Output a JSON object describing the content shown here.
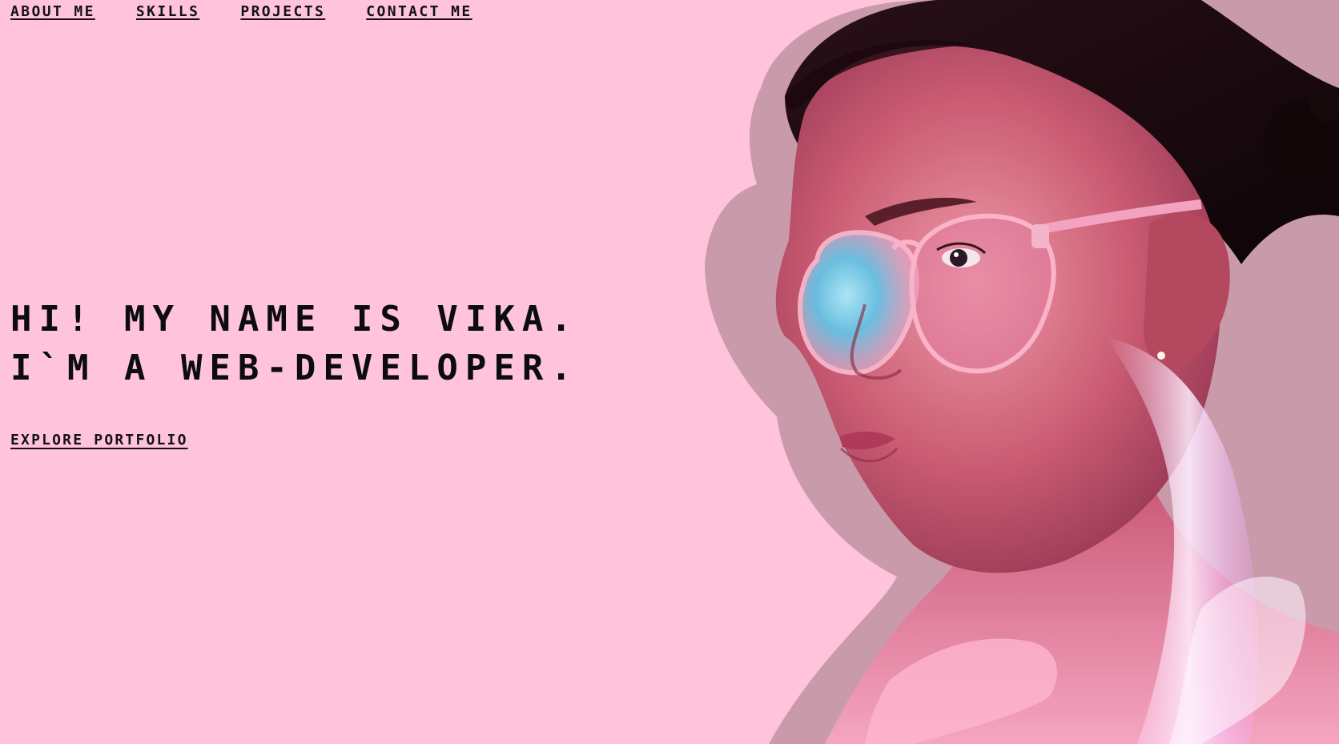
{
  "nav": {
    "items": [
      {
        "label": "ABOUT ME"
      },
      {
        "label": "SKILLS"
      },
      {
        "label": "PROJECTS"
      },
      {
        "label": "CONTACT ME"
      }
    ]
  },
  "hero": {
    "line1": "HI! MY NAME IS VIKA.",
    "line2": "I`M A WEB-DEVELOPER.",
    "cta_label": "EXPLORE PORTFOLIO",
    "photo": "portrait-with-pink-glasses"
  },
  "colors": {
    "background": "#ffc4dc",
    "text": "#0b0b10"
  }
}
